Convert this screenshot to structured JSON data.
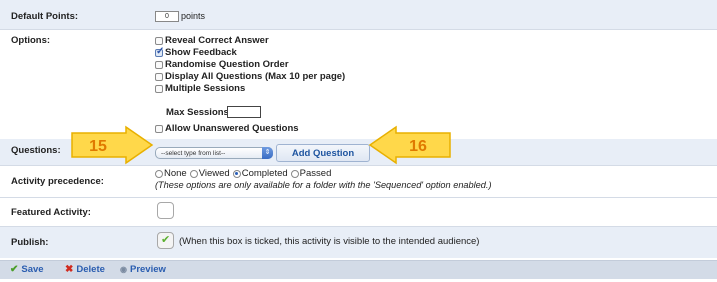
{
  "default_points": {
    "label": "Default Points:",
    "value": "0",
    "unit": "points"
  },
  "options": {
    "label": "Options:",
    "items": [
      {
        "label": "Reveal Correct Answer",
        "checked": false
      },
      {
        "label": "Show Feedback",
        "checked": true
      },
      {
        "label": "Randomise Question Order",
        "checked": false
      },
      {
        "label": "Display All Questions (Max 10 per page)",
        "checked": false
      },
      {
        "label": "Multiple Sessions",
        "checked": false
      },
      {
        "label": "Allow Unanswered Questions",
        "checked": false
      }
    ],
    "max_sessions_label": "Max Sessions:",
    "max_sessions_value": ""
  },
  "questions": {
    "label": "Questions:",
    "select_value": "--select type from list--",
    "add_button": "Add Question",
    "callout_left": "15",
    "callout_right": "16"
  },
  "precedence": {
    "label": "Activity precedence:",
    "options": [
      "None",
      "Viewed",
      "Completed",
      "Passed"
    ],
    "selected": "Completed",
    "note": "(These options are only available for a folder with the 'Sequenced' option enabled.)"
  },
  "featured": {
    "label": "Featured Activity:",
    "checked": false
  },
  "publish": {
    "label": "Publish:",
    "checked": true,
    "note": "(When this box is ticked, this activity is visible to the intended audience)"
  },
  "toolbar": {
    "save": "Save",
    "delete": "Delete",
    "preview": "Preview"
  },
  "colors": {
    "link": "#2a5db0",
    "callout_fill": "#ffd84a",
    "callout_text": "#e07a00",
    "band": "#e8eef7"
  }
}
